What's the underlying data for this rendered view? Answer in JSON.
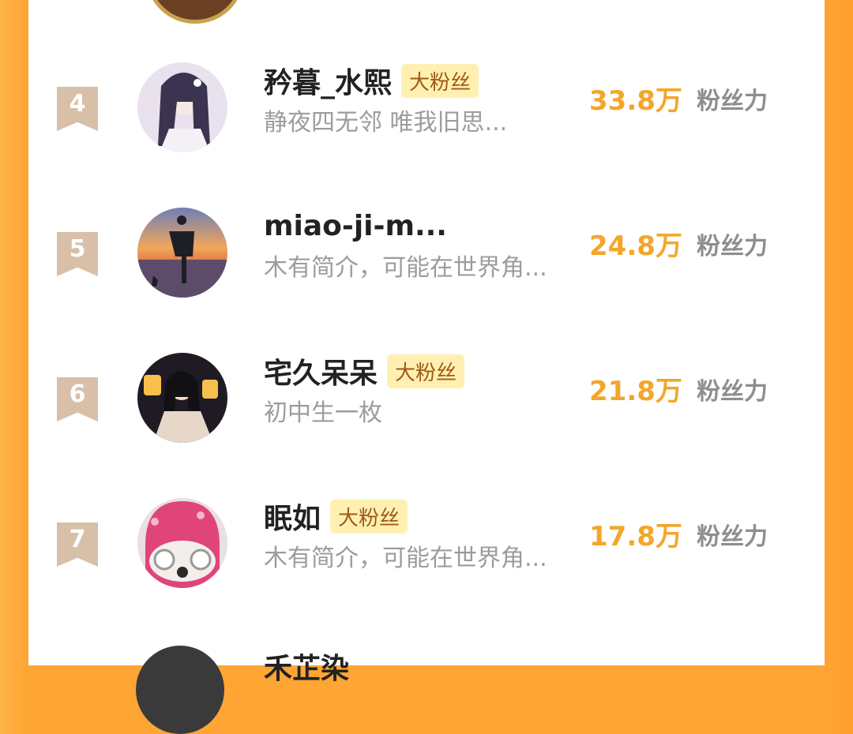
{
  "leaderboard": {
    "entries": [
      {
        "rank": "4",
        "name": "矜暮_水熙",
        "badge": "大粉丝",
        "bio": "静夜四无邻 唯我旧思...",
        "score": "33.8万",
        "score_unit": "粉丝力"
      },
      {
        "rank": "5",
        "name": "miao-ji-m...",
        "badge": "",
        "bio": "木有简介，可能在世界角...",
        "score": "24.8万",
        "score_unit": "粉丝力"
      },
      {
        "rank": "6",
        "name": "宅久呆呆",
        "badge": "大粉丝",
        "bio": "初中生一枚",
        "score": "21.8万",
        "score_unit": "粉丝力"
      },
      {
        "rank": "7",
        "name": "眠如",
        "badge": "大粉丝",
        "bio": "木有简介，可能在世界角...",
        "score": "17.8万",
        "score_unit": "粉丝力"
      }
    ],
    "partial_next_name": "禾芷染"
  },
  "colors": {
    "accent_orange": "#FFA534",
    "score_orange": "#F4A62A",
    "badge_bg": "#FFF0B2",
    "badge_text": "#A05A15",
    "rank_ribbon": "#D8BFA8"
  },
  "icons": {
    "rank_marker": "ribbon-bookmark"
  }
}
